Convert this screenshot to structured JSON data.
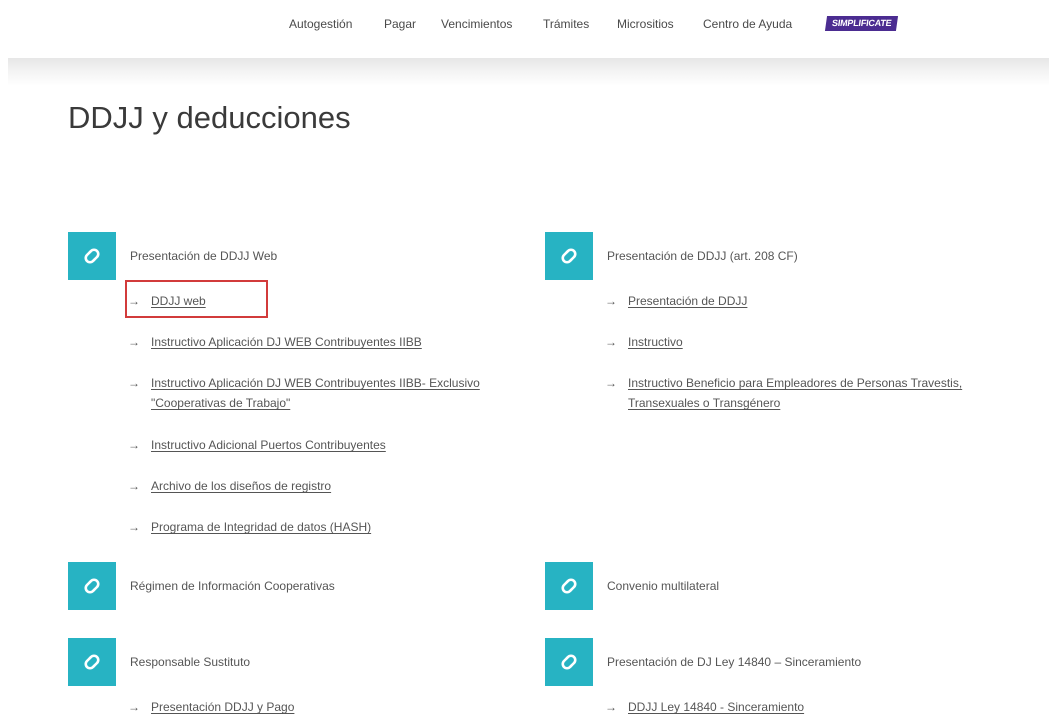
{
  "nav": {
    "items": [
      "Autogestión",
      "Pagar",
      "Vencimientos",
      "Trámites",
      "Micrositios",
      "Centro de Ayuda"
    ],
    "badge": "SIMPLIFICATE"
  },
  "page": {
    "title": "DDJJ y deducciones"
  },
  "colors": {
    "icon_bg": "#27b3c3",
    "badge_bg": "#4b2c91",
    "highlight": "#d23b3b"
  },
  "sections": [
    {
      "icon": "link-icon",
      "title": "Presentación de DDJJ Web",
      "links": [
        "DDJJ web",
        "Instructivo Aplicación DJ WEB Contribuyentes IIBB",
        "Instructivo Aplicación DJ WEB Contribuyentes IIBB- Exclusivo",
        "\"Cooperativas de Trabajo\"",
        "Instructivo Adicional Puertos Contribuyentes",
        "Archivo de los diseños de registro",
        "Programa de Integridad de datos (HASH)"
      ]
    },
    {
      "icon": "link-icon",
      "title": "Presentación de DDJJ (art. 208 CF)",
      "links": [
        "Presentación de DDJJ",
        "Instructivo",
        "Instructivo Beneficio para Empleadores de Personas Travestis,",
        "Transexuales o Transgénero"
      ]
    },
    {
      "icon": "link-icon",
      "title": "Régimen de Información Cooperativas",
      "links": []
    },
    {
      "icon": "link-icon",
      "title": "Convenio multilateral",
      "links": []
    },
    {
      "icon": "link-icon",
      "title": "Responsable Sustituto",
      "links": [
        "Presentación DDJJ y Pago"
      ]
    },
    {
      "icon": "link-icon",
      "title": "Presentación de DJ Ley 14840 – Sinceramiento",
      "links": [
        "DDJJ Ley 14840 - Sinceramiento"
      ]
    }
  ]
}
